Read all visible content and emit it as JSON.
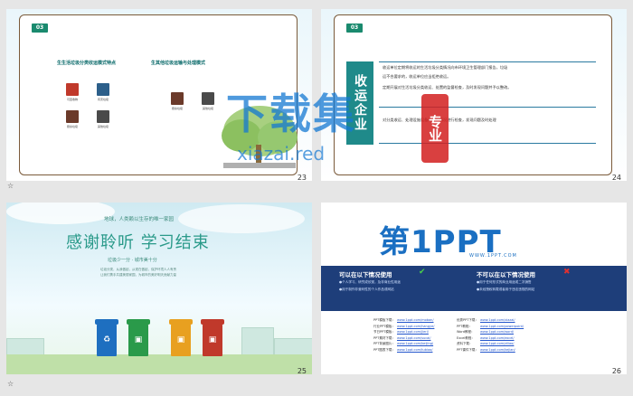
{
  "slides": [
    {
      "number": "23",
      "badge": "03",
      "panel_left_title": "生生活垃圾分类收运模式特点",
      "panel_right_title": "生其他垃圾运输与处理模式",
      "icons_left": [
        {
          "name": "可回收物",
          "color": "#c0392b"
        },
        {
          "name": "有害垃圾",
          "color": "#2c5f8a"
        },
        {
          "name": "厨余垃圾",
          "color": "#6b3a2a"
        },
        {
          "name": "其他垃圾",
          "color": "#4a4a4a"
        }
      ],
      "icons_right": [
        {
          "name": "厨余垃圾",
          "color": "#6b3a2a"
        },
        {
          "name": "其他垃圾",
          "color": "#4a4a4a"
        }
      ]
    },
    {
      "number": "24",
      "badge": "03",
      "vertical_title": "收运企业",
      "lines": [
        "收运单位定期将收运的生活垃圾分类情况向市环境卫生管理部门报告，垃圾",
        "运不合要求的，收运单位应当拒绝收运。",
        "定期开展对生活垃圾分类收运、处置的监督检查，及时发现问题并予以整改。",
        "对分类收运、处理设施设备的运行情况进行检查，发现问题及时处理"
      ]
    },
    {
      "number": "25",
      "top_line": "地球，人类赖以生存的唯一家园",
      "title": "感谢聆听  学习结束",
      "slogan": "垃圾少一分 · 城市美十分",
      "small_lines": [
        "垃圾分类，从我做起，从现在做起，保护环境人人有责",
        "让我们携手共建美丽家园，为城市的美好明天贡献力量"
      ],
      "bins": [
        "#1e6fc0",
        "#2a9a4a",
        "#e8a020",
        "#c0392b"
      ]
    },
    {
      "number": "26",
      "logo_text": "第1PPT",
      "logo_url": "WWW.1PPT.COM",
      "allowed_title": "可以在以下情况使用",
      "allowed_lines": [
        "●个人学习、研究或欣赏，及非商业性用途",
        "●用于制作非营利性的个人作品或网站"
      ],
      "forbidden_title": "不可以在以下情况使用",
      "forbidden_lines": [
        "●用于任何形式的商业用途或二次销售",
        "●未经授权转载或者用于违法违规的网站"
      ],
      "link_heads_left": [
        "PPT模板下载：",
        "行业PPT模板：",
        "节日PPT模板：",
        "PPT素材下载：",
        "PPT背景图片：",
        "PPT图表下载："
      ],
      "links_left": [
        "www.1ppt.com/moban/",
        "www.1ppt.com/hangye/",
        "www.1ppt.com/jieri/",
        "www.1ppt.com/sucai/",
        "www.1ppt.com/beijing/",
        "www.1ppt.com/tubiao/"
      ],
      "link_heads_right": [
        "优秀PPT下载：",
        "PPT教程：",
        "Word教程：",
        "Excel教程：",
        "资料下载：",
        "PPT课件下载："
      ],
      "links_right": [
        "www.1ppt.com/xiazai/",
        "www.1ppt.com/powerpoint/",
        "www.1ppt.com/word/",
        "www.1ppt.com/excel/",
        "www.1ppt.com/ziliao/",
        "www.1ppt.com/kejian/"
      ]
    }
  ],
  "watermark": {
    "big_text": "下载集",
    "url": "xiazai.red",
    "red_label": "专业"
  },
  "star_glyph": "☆"
}
